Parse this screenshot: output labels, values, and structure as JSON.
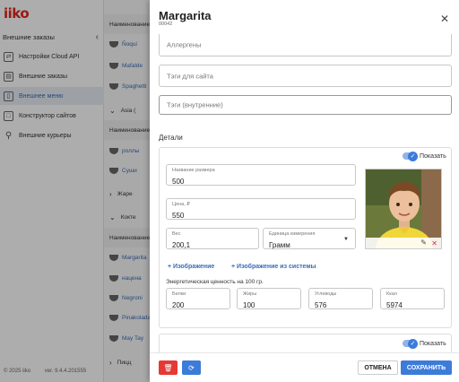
{
  "app": {
    "logo": "iiko",
    "section": "Внешние заказы",
    "collapse_icon": "chevron-left-icon",
    "nav": [
      {
        "label": "Настройки Cloud API",
        "icon": "api-settings-icon"
      },
      {
        "label": "Внешние заказы",
        "icon": "orders-icon"
      },
      {
        "label": "Внешнее меню",
        "icon": "menu-book-icon"
      },
      {
        "label": "Конструктор сайтов",
        "icon": "site-builder-icon"
      },
      {
        "label": "Внешние курьеры",
        "icon": "bicycle-icon"
      }
    ],
    "active_nav": "Внешнее меню",
    "copyright": "© 2025 iiko",
    "version": "ver. 9.4.4.201555"
  },
  "list": {
    "rows": [
      {
        "text": "Наименование",
        "kind": "head"
      },
      {
        "text": "Ñoqui",
        "kind": "item"
      },
      {
        "text": "Mafalde",
        "kind": "item"
      },
      {
        "text": "Spaghetti",
        "kind": "item"
      },
      {
        "text": "Asia (",
        "kind": "group"
      },
      {
        "text": "Наименование",
        "kind": "head"
      },
      {
        "text": "роллы",
        "kind": "item"
      },
      {
        "text": "Суши",
        "kind": "item"
      },
      {
        "text": "Жаре",
        "kind": "group-collapsed"
      },
      {
        "text": "Кокте",
        "kind": "group"
      },
      {
        "text": "Наименование",
        "kind": "head"
      },
      {
        "text": "Margarita",
        "kind": "item"
      },
      {
        "text": "нацена",
        "kind": "item"
      },
      {
        "text": "Negroni",
        "kind": "item"
      },
      {
        "text": "Pinakolada",
        "kind": "item"
      },
      {
        "text": "May Tay",
        "kind": "item"
      },
      {
        "text": "Пицц",
        "kind": "group-collapsed"
      }
    ]
  },
  "drawer": {
    "title": "Margarita",
    "subtitle": "00042",
    "close_icon": "close-icon",
    "allergens_placeholder": "Аллергены",
    "site_tags_placeholder": "Тэги для сайта",
    "internal_tags_placeholder": "Тэги (внутренние)",
    "details_title": "Детали",
    "card": {
      "show_label": "Показать",
      "show_toggle": true,
      "size_name_label": "Название размера",
      "size_name_value": "500",
      "price_label": "Цена, ₽",
      "price_value": "550",
      "weight_label": "Вес",
      "weight_value": "200,1",
      "unit_label": "Единица измерения",
      "unit_value": "Грамм",
      "add_image": "+ Изображение",
      "add_system_image": "+ Изображение из системы",
      "energy_title": "Энергетическая ценность на 100 гр.",
      "nutrients": [
        {
          "label": "Белки",
          "value": "200"
        },
        {
          "label": "Жиры",
          "value": "100"
        },
        {
          "label": "Углеводы",
          "value": "576"
        },
        {
          "label": "Ккал",
          "value": "5974"
        }
      ]
    },
    "card2": {
      "show_label": "Показать"
    },
    "footer": {
      "delete_icon": "trash-icon",
      "refresh_icon": "refresh-icon",
      "cancel": "ОТМЕНА",
      "save": "СОХРАНИТЬ"
    }
  },
  "colors": {
    "accent": "#3d7bd9",
    "brand": "#e1251b",
    "danger": "#e53935",
    "overlay": "rgba(0,0,0,0.32)"
  }
}
